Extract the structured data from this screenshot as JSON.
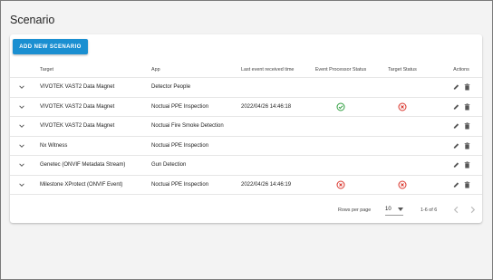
{
  "page": {
    "title": "Scenario"
  },
  "toolbar": {
    "add_label": "ADD NEW SCENARIO"
  },
  "table": {
    "headers": {
      "target": "Target",
      "app": "App",
      "last_event": "Last event received time",
      "event_processor_status": "Event Processor Status",
      "target_status": "Target Status",
      "actions": "Actions"
    },
    "rows": [
      {
        "target": "VIVOTEK VAST2 Data Magnet",
        "app": "Detector People",
        "last_event": "",
        "event_processor_status": "",
        "target_status": ""
      },
      {
        "target": "VIVOTEK VAST2 Data Magnet",
        "app": "Noctuai PPE Inspection",
        "last_event": "2022/04/26 14:46:18",
        "event_processor_status": "ok",
        "target_status": "error"
      },
      {
        "target": "VIVOTEK VAST2 Data Magnet",
        "app": "Noctuai Fire Smoke Detection",
        "last_event": "",
        "event_processor_status": "",
        "target_status": ""
      },
      {
        "target": "Nx Witness",
        "app": "Noctuai PPE Inspection",
        "last_event": "",
        "event_processor_status": "",
        "target_status": ""
      },
      {
        "target": "Genetec (ONVIF Metadata Stream)",
        "app": "Gun Detection",
        "last_event": "",
        "event_processor_status": "",
        "target_status": ""
      },
      {
        "target": "Milestone XProtect (ONVIF Event)",
        "app": "Noctuai PPE Inspection",
        "last_event": "2022/04/26 14:46:19",
        "event_processor_status": "error",
        "target_status": "error"
      }
    ]
  },
  "pagination": {
    "rows_per_page_label": "Rows per page",
    "rows_per_page_value": "10",
    "range_label": "1-6 of 6"
  },
  "colors": {
    "primary": "#1a8fd1",
    "ok": "#2e9e3e",
    "error": "#d9342b"
  },
  "icons": {
    "expand": "chevron-down-icon",
    "ok": "check-circle-icon",
    "error": "x-circle-icon",
    "edit": "pencil-icon",
    "delete": "trash-icon",
    "prev": "chevron-left-icon",
    "next": "chevron-right-icon"
  }
}
